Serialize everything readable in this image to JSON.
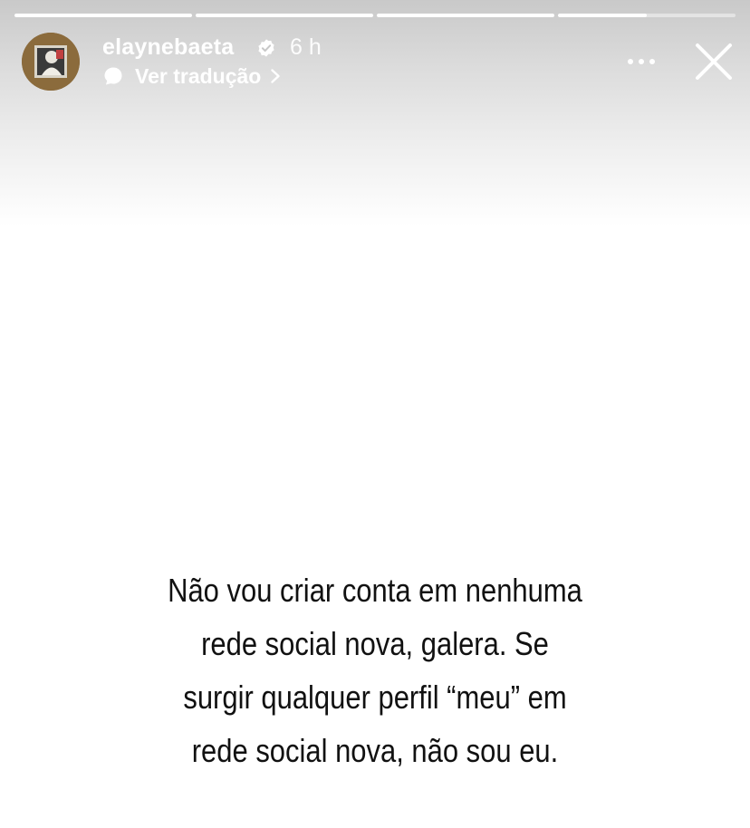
{
  "story": {
    "username": "elaynebaeta",
    "time_ago": "6 h",
    "translate_label": "Ver tradução",
    "progress_segments": [
      1,
      1,
      1,
      0.5
    ],
    "caption_lines": [
      "Não vou criar conta em nenhuma",
      "rede social nova, galera. Se",
      "surgir qualquer perfil “meu” em",
      "rede social nova, não sou eu."
    ]
  },
  "icons": {
    "verified": "verified-badge-icon",
    "translate": "speech-bubble-icon",
    "chevron": "chevron-right-icon",
    "more": "more-options-icon",
    "close": "close-icon"
  },
  "colors": {
    "header_text": "#ffffff",
    "caption_text": "#111111",
    "background": "#ffffff"
  }
}
